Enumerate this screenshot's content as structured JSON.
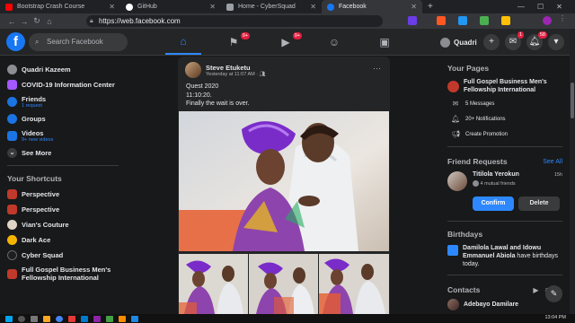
{
  "browser": {
    "tabs": [
      {
        "label": "Bootstrap Crash Course",
        "color": "#ff0000"
      },
      {
        "label": "GitHub",
        "color": "#ffffff"
      },
      {
        "label": "Home - CyberSquad",
        "color": "#9aa0a6"
      },
      {
        "label": "Facebook",
        "color": "#1877f2"
      }
    ],
    "new_tab": "+",
    "url": "https://web.facebook.com"
  },
  "header": {
    "logo": "f",
    "search_placeholder": "Search Facebook",
    "groups_badge": "9+",
    "watch_badge": "9+",
    "profile_name": "Quadri",
    "messenger_badge": "1",
    "notif_badge": "58"
  },
  "left_nav": {
    "items": [
      {
        "label": "Quadri Kazeem",
        "sub": ""
      },
      {
        "label": "COVID-19 Information Center",
        "sub": ""
      },
      {
        "label": "Friends",
        "sub": "1 request"
      },
      {
        "label": "Groups",
        "sub": ""
      },
      {
        "label": "Videos",
        "sub": "9+ new videos"
      },
      {
        "label": "See More",
        "sub": ""
      }
    ],
    "shortcuts_title": "Your Shortcuts",
    "shortcuts": [
      "Perspective",
      "Perspective",
      "Vian's Couture",
      "Dark Ace",
      "Cyber Squad",
      "Full Gospel Business Men's Fellowship International"
    ]
  },
  "post": {
    "author": "Steve Etuketu",
    "meta": "Yesterday at 11:07 AM · ",
    "lines": [
      "Quest 2020",
      "11:10:20.",
      "Finally the wait is over."
    ]
  },
  "right": {
    "pages_title": "Your Pages",
    "page_name": "Full Gospel Business Men's Fellowship International",
    "page_actions": [
      "5 Messages",
      "20+ Notifications",
      "Create Promotion"
    ],
    "requests_title": "Friend Requests",
    "see_all": "See All",
    "request": {
      "name": "Titilola Yerokun",
      "mutual": "4 mutual friends",
      "time": "15h",
      "confirm": "Confirm",
      "delete": "Delete"
    },
    "birthdays_title": "Birthdays",
    "birthday_names": "Damilola Lawal and Idowu Emmanuel Abiola",
    "birthday_rest": " have birthdays today.",
    "contacts_title": "Contacts",
    "contact": "Adebayo Damilare"
  },
  "taskbar": {
    "time": "13:04 PM"
  }
}
